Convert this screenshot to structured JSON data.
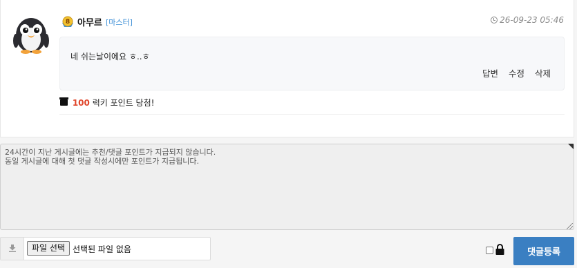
{
  "comment": {
    "author": "아무르",
    "level": "8",
    "role": "[마스터]",
    "date": "26-09-23 05:46",
    "body": "네 쉬는날이에요 ㅎ..ㅎ",
    "actions": {
      "reply": "답변",
      "edit": "수정",
      "delete": "삭제"
    },
    "lucky": {
      "points": "100",
      "text": "럭키 포인트 당첨!"
    }
  },
  "form": {
    "placeholder": "24시간이 지난 게시글에는 추천/댓글 포인트가 지급되지 않습니다.\n동일 게시글에 대해 첫 댓글 작성시에만 포인트가 지급됩니다.",
    "file_button": "파일 선택",
    "file_status": "선택된 파일 없음",
    "submit": "댓글등록"
  },
  "colors": {
    "accent": "#3a7fc2",
    "role": "#3d8fd6",
    "points": "#e0452a"
  },
  "icons": [
    "penguin-avatar",
    "level-badge-icon",
    "clock-icon",
    "gift-icon",
    "upload-icon",
    "lock-icon"
  ]
}
